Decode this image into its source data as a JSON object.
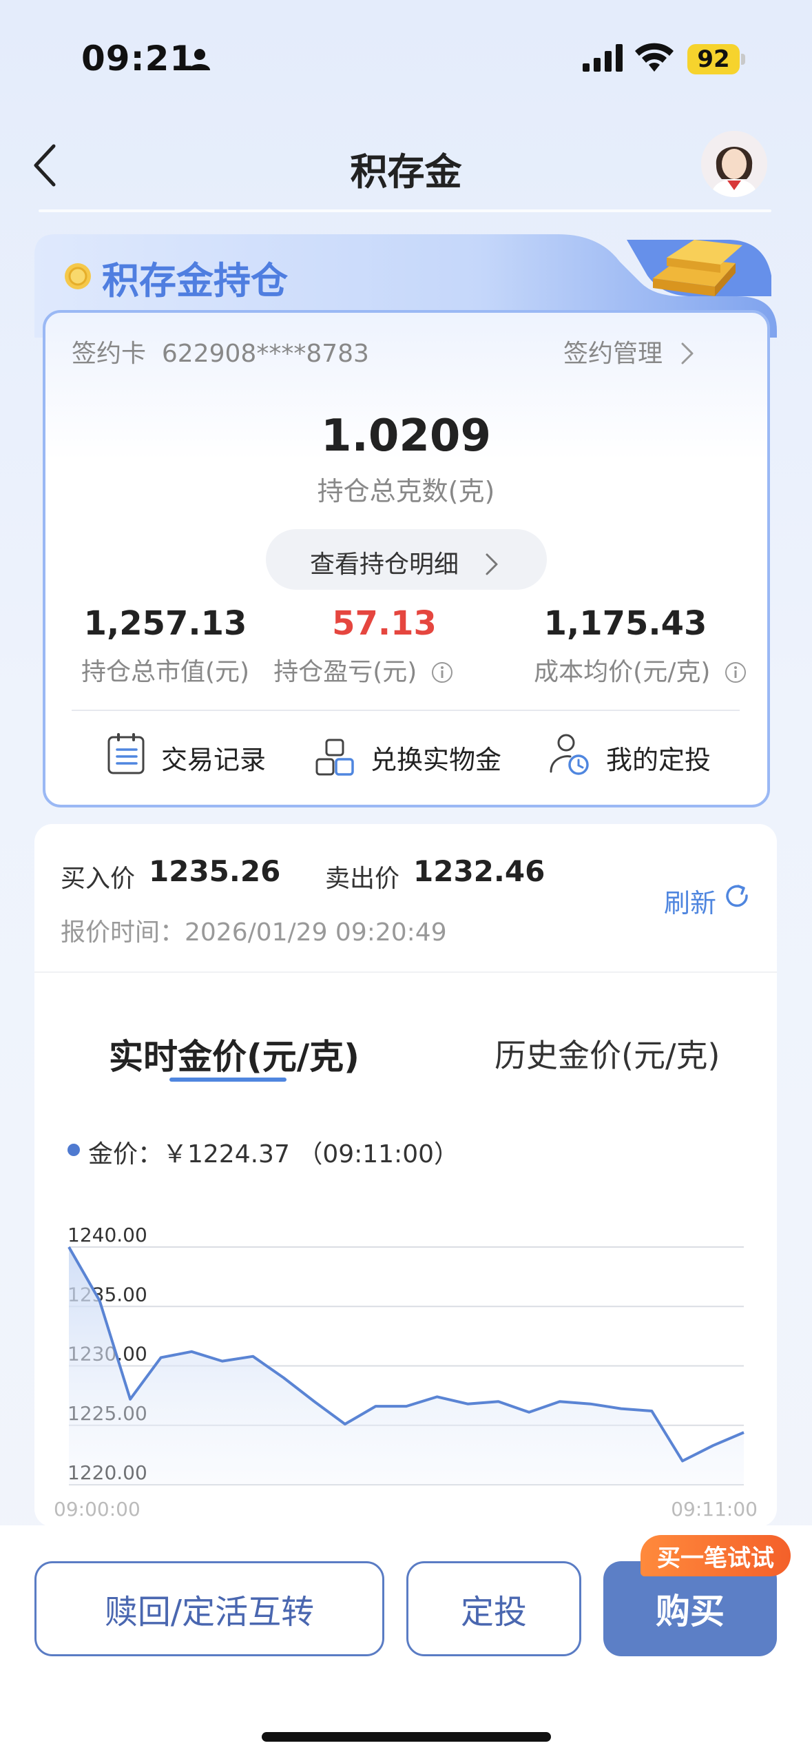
{
  "status_bar": {
    "time": "09:21",
    "battery": "92"
  },
  "nav": {
    "title": "积存金"
  },
  "holdings": {
    "section_title": "积存金持仓",
    "card_label": "签约卡",
    "card_number": "622908****8783",
    "manage_label": "签约管理",
    "total_grams": "1.0209",
    "total_grams_label": "持仓总克数(克)",
    "detail_button": "查看持仓明细",
    "stats": [
      {
        "value": "1,257.13",
        "label": "持仓总市值(元)",
        "color": "#222222"
      },
      {
        "value": "57.13",
        "label": "持仓盈亏(元)",
        "color": "#e5463f"
      },
      {
        "value": "1,175.43",
        "label": "成本均价(元/克)",
        "color": "#222222"
      }
    ],
    "quick_actions": [
      {
        "label": "交易记录",
        "icon": "document-list-icon"
      },
      {
        "label": "兑换实物金",
        "icon": "exchange-blocks-icon"
      },
      {
        "label": "我的定投",
        "icon": "user-clock-icon"
      }
    ]
  },
  "price": {
    "buy_label": "买入价",
    "buy_value": "1235.26",
    "sell_label": "卖出价",
    "sell_value": "1232.46",
    "refresh_label": "刷新",
    "quote_time": "报价时间：2026/01/29 09:20:49"
  },
  "tabs": {
    "realtime": "实时金价(元/克)",
    "history": "历史金价(元/克)"
  },
  "legend": {
    "text": "金价：￥1224.37  （09:11:00）"
  },
  "chart_data": {
    "type": "area",
    "x_start": "09:00:00",
    "x_end": "09:11:00",
    "y_ticks": [
      "1240.00",
      "1235.00",
      "1230.00",
      "1225.00",
      "1220.00"
    ],
    "ylim": [
      1220,
      1240
    ],
    "values": [
      1240.0,
      1235.5,
      1227.2,
      1230.7,
      1231.2,
      1230.4,
      1230.8,
      1229.0,
      1227.0,
      1225.1,
      1226.6,
      1226.6,
      1227.4,
      1226.8,
      1227.0,
      1226.1,
      1227.0,
      1226.8,
      1226.4,
      1226.2,
      1222.0,
      1223.3,
      1224.4
    ],
    "line_color": "#5a84d4",
    "grid": true
  },
  "actions": {
    "redeem": "赎回/定活互转",
    "fixed": "定投",
    "buy": "购买",
    "promo": "买一笔试试"
  }
}
